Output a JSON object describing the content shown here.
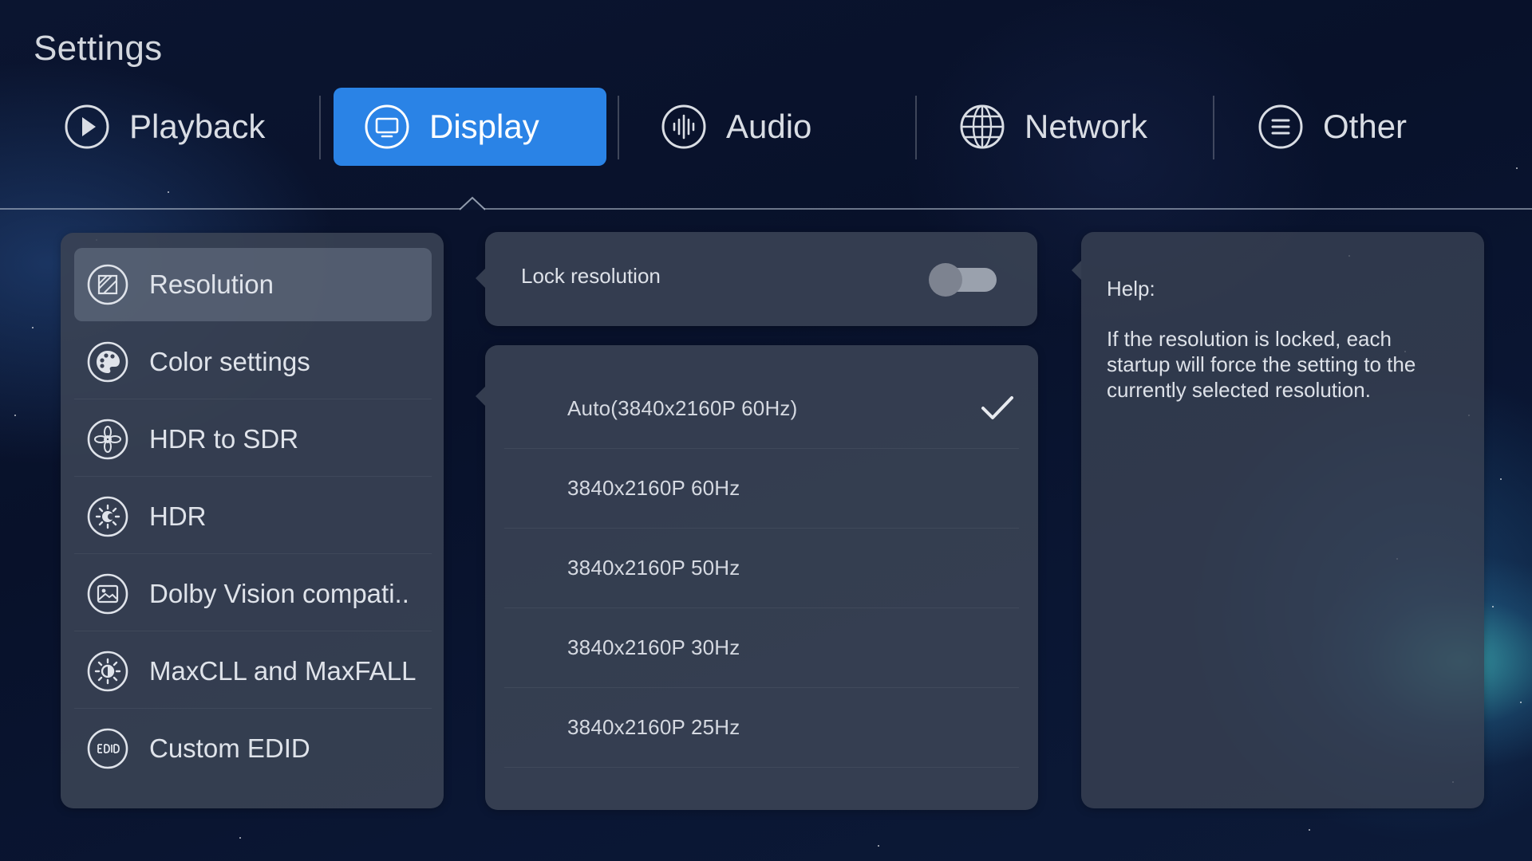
{
  "app": {
    "title": "Settings"
  },
  "tabs": [
    {
      "label": "Playback",
      "icon": "play-circle-icon",
      "active": false
    },
    {
      "label": "Display",
      "icon": "monitor-icon",
      "active": true
    },
    {
      "label": "Audio",
      "icon": "audio-waveform-icon",
      "active": false
    },
    {
      "label": "Network",
      "icon": "globe-icon",
      "active": false
    },
    {
      "label": "Other",
      "icon": "menu-lines-icon",
      "active": false
    }
  ],
  "sidebar": {
    "items": [
      {
        "label": "Resolution",
        "icon": "resolution-icon",
        "selected": true
      },
      {
        "label": "Color settings",
        "icon": "palette-icon",
        "selected": false
      },
      {
        "label": "HDR to SDR",
        "icon": "aperture-icon",
        "selected": false
      },
      {
        "label": "HDR",
        "icon": "hdr-brightness-icon",
        "selected": false
      },
      {
        "label": "Dolby Vision compati..",
        "icon": "image-icon",
        "selected": false
      },
      {
        "label": "MaxCLL and MaxFALL",
        "icon": "brightness-icon",
        "selected": false
      },
      {
        "label": "Custom EDID",
        "icon": "edid-icon",
        "selected": false
      }
    ]
  },
  "lock": {
    "label": "Lock resolution",
    "enabled": false
  },
  "resolutions": {
    "options": [
      {
        "label": "Auto(3840x2160P 60Hz)",
        "checked": true
      },
      {
        "label": "3840x2160P  60Hz",
        "checked": false
      },
      {
        "label": "3840x2160P  50Hz",
        "checked": false
      },
      {
        "label": "3840x2160P  30Hz",
        "checked": false
      },
      {
        "label": "3840x2160P  25Hz",
        "checked": false
      }
    ]
  },
  "help": {
    "title": "Help:",
    "text": "If the resolution is locked, each startup will force the setting to the currently selected resolution."
  },
  "colors": {
    "accent": "#2a83e6",
    "panel": "#3a4254",
    "background": "#0b1530"
  }
}
